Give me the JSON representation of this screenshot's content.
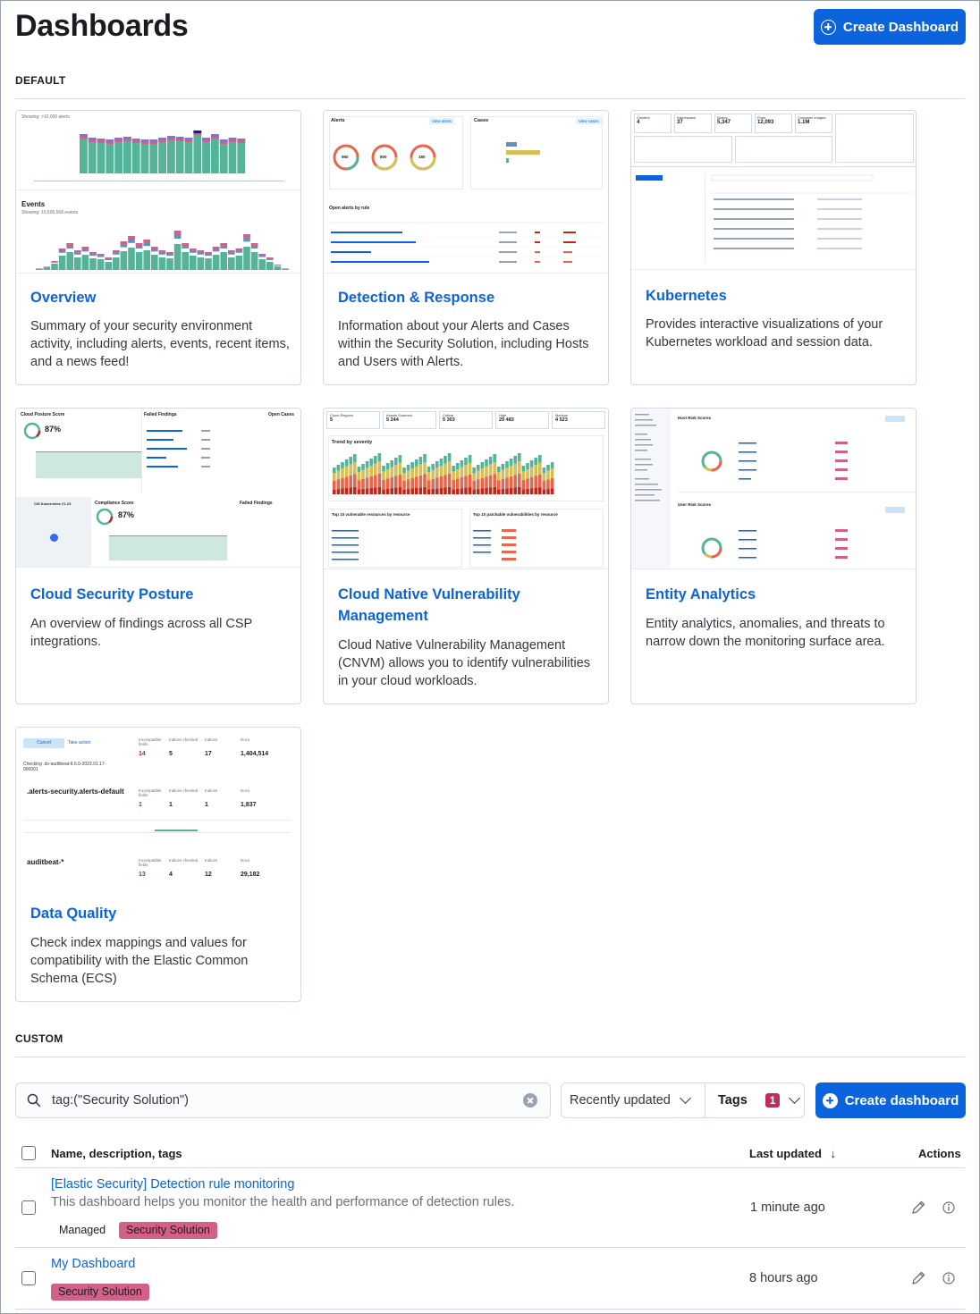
{
  "page": {
    "title": "Dashboards",
    "create_button": "Create Dashboard"
  },
  "default_section": {
    "label": "DEFAULT",
    "cards": [
      {
        "title": "Overview",
        "description": "Summary of your security environment activity, including alerts, events, recent items, and a news feed!"
      },
      {
        "title": "Detection & Response",
        "description": "Information about your Alerts and Cases within the Security Solution, including Hosts and Users with Alerts."
      },
      {
        "title": "Kubernetes",
        "description": "Provides interactive visualizations of your Kubernetes workload and session data."
      },
      {
        "title": "Cloud Security Posture",
        "description": "An overview of findings across all CSP integrations."
      },
      {
        "title": "Cloud Native Vulnerability Management",
        "description": "Cloud Native Vulnerability Management (CNVM) allows you to identify vulnerabilities in your cloud workloads."
      },
      {
        "title": "Entity Analytics",
        "description": "Entity analytics, anomalies, and threats to narrow down the monitoring surface area."
      },
      {
        "title": "Data Quality",
        "description": "Check index mappings and values for compatibility with the Elastic Common Schema (ECS)"
      }
    ]
  },
  "thumbnails": {
    "overview": {
      "top_caption": "Showing: >10,000 alerts",
      "events_label": "Events",
      "events_caption": "Showing: 10,500,568 events"
    },
    "detection": {
      "alerts_label": "Alerts",
      "cases_label": "Cases",
      "view_alerts": "View alerts",
      "view_cases": "View cases",
      "donut_values": [
        "960",
        "800",
        "180"
      ],
      "open_alerts_label": "Open alerts by rule"
    },
    "kubernetes": {
      "stats": [
        {
          "label": "Clusters",
          "value": "4"
        },
        {
          "label": "Namespace",
          "value": "37"
        },
        {
          "label": "Nodes",
          "value": "5,347"
        },
        {
          "label": "Pods",
          "value": "12,093"
        },
        {
          "label": "Container images",
          "value": "1.1M"
        }
      ]
    },
    "csp": {
      "score_label": "Cloud Posture Score",
      "score": "87%",
      "failed_label": "Failed Findings",
      "open_cases": "Open Cases",
      "compliance_label": "Compliance Score",
      "compliance": "87%",
      "cluster": "CIS Kubernetes V1.23"
    },
    "cnvm": {
      "stats": [
        {
          "label": "Cloud Regions",
          "value": "5"
        },
        {
          "label": "Assets Scanned",
          "value": "5 244"
        },
        {
          "label": "Critical",
          "value": "5 303"
        },
        {
          "label": "High",
          "value": "29 483"
        },
        {
          "label": "Medium",
          "value": "4 523"
        }
      ],
      "trend_label": "Trend by severity",
      "top_resources": "Top 10 vulnerable resources by resource",
      "top_patchable": "Top 10 patchable vulnerabilities by resource"
    },
    "entity": {
      "host_label": "Host Risk Scores",
      "user_label": "User Risk Scores"
    },
    "dq": {
      "cancel": "Cancel",
      "take_action": "Take action",
      "rows": [
        {
          "name": "Checking .ds-auditbeat-8.6.0-2023.01.17-000001",
          "incompatible": "14",
          "checked": "5",
          "indices": "17",
          "docs": "1,404,514"
        },
        {
          "name": ".alerts-security.alerts-default",
          "incompatible": "1",
          "checked": "1",
          "indices": "1",
          "docs": "1,837"
        },
        {
          "name": "auditbeat-*",
          "incompatible": "13",
          "checked": "4",
          "indices": "12",
          "docs": "29,182"
        }
      ]
    }
  },
  "custom_section": {
    "label": "CUSTOM",
    "search_query": "tag:(\"Security Solution\")",
    "sort_label": "Recently updated",
    "tags_label": "Tags",
    "tags_count": "1",
    "create_button": "Create dashboard",
    "columns": {
      "name": "Name, description, tags",
      "updated": "Last updated",
      "actions": "Actions"
    },
    "rows": [
      {
        "title": "[Elastic Security] Detection rule monitoring",
        "description": "This dashboard helps you monitor the health and performance of detection rules.",
        "tags": [
          "Managed",
          "Security Solution"
        ],
        "updated": "1 minute ago"
      },
      {
        "title": "My Dashboard",
        "description": "",
        "tags": [
          "Security Solution"
        ],
        "updated": "8 hours ago"
      }
    ]
  },
  "colors": {
    "primary": "#0b64dd",
    "tag_pink": "#d36086",
    "badge": "#bd2f5a",
    "chart_green": "#54b399",
    "chart_blue": "#6092c0",
    "chart_purple": "#9170b8",
    "chart_red": "#d36086"
  }
}
